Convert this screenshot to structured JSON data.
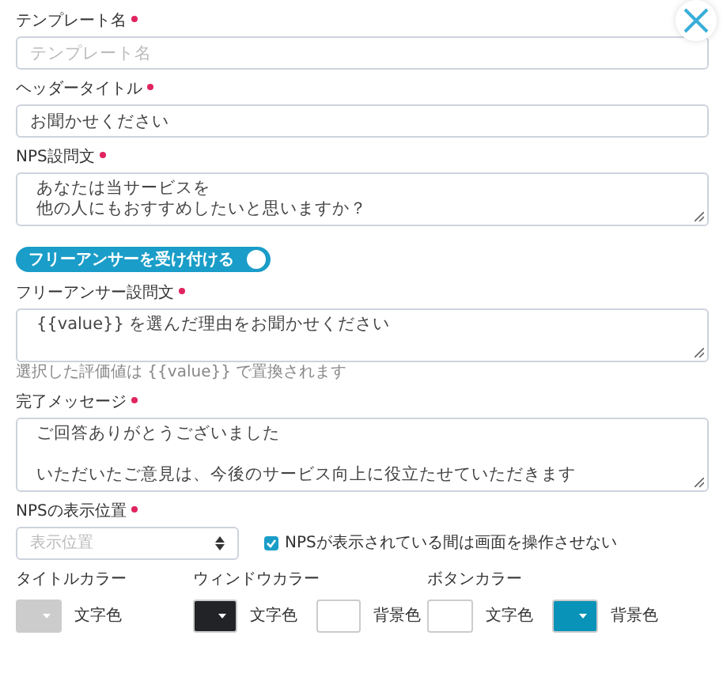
{
  "fields": [
    {
      "kind": "input",
      "label": "テンプレート名",
      "required": true,
      "placeholder": "テンプレート名"
    },
    {
      "kind": "input",
      "label": "ヘッダータイトル",
      "required": true,
      "value": "お聞かせください"
    },
    {
      "kind": "textarea",
      "label": "NPS設問文",
      "required": true,
      "lines": [
        "あなたは当サービスを",
        "他の人にもおすすめしたいと思いますか？"
      ]
    },
    {
      "kind": "toggle",
      "label": "フリーアンサーを受け付ける",
      "on": true
    },
    {
      "kind": "textarea",
      "label": "フリーアンサー設問文",
      "required": true,
      "lines": [
        "{{value}} を選んだ理由をお聞かせください"
      ],
      "hint": "選択した評価値は {{value}} で置換されます"
    },
    {
      "kind": "textarea",
      "label": "完了メッセージ",
      "required": true,
      "paragraphs": [
        "ご回答ありがとうございました",
        "いただいたご意見は、今後のサービス向上に役立たせていただきます"
      ]
    }
  ],
  "position": {
    "label": "NPSの表示位置",
    "required": true,
    "placeholder": "表示位置",
    "checkbox": {
      "label": "NPSが表示されている間は画面を操作させない",
      "checked": true
    }
  },
  "color_groups": [
    {
      "label": "タイトルカラー",
      "swatches": [
        {
          "color": "#cccccc",
          "dropdown": true,
          "label": "文字色"
        }
      ]
    },
    {
      "label": "ウィンドウカラー",
      "swatches": [
        {
          "color": "#212326",
          "dropdown": true,
          "label": "文字色"
        },
        {
          "color": "#ffffff",
          "dropdown": false,
          "label": "背景色"
        }
      ]
    },
    {
      "label": "ボタンカラー",
      "swatches": [
        {
          "color": "#ffffff",
          "dropdown": false,
          "label": "文字色"
        },
        {
          "color": "#0a93b8",
          "dropdown": true,
          "label": "背景色"
        }
      ]
    }
  ]
}
